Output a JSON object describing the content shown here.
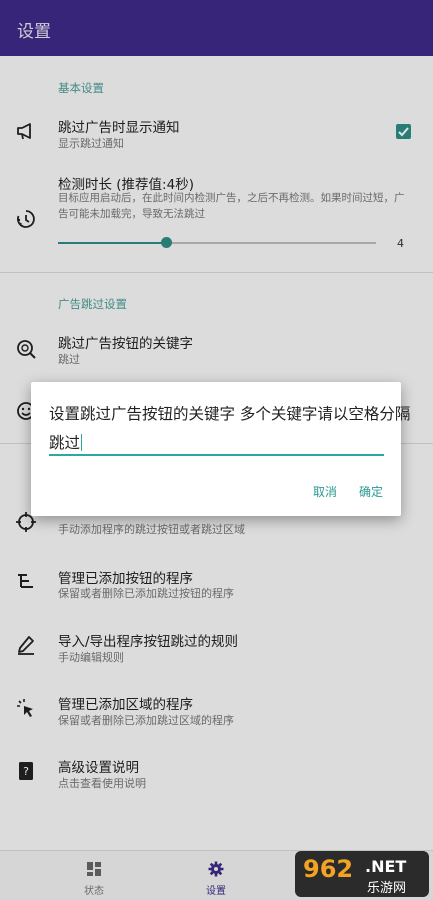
{
  "app": {
    "title": "设置"
  },
  "basic": {
    "section_title": "基本设置",
    "notify": {
      "title": "跳过广告时显示通知",
      "subtitle": "显示跳过通知",
      "checked": true
    },
    "duration": {
      "title": "检测时长 (推荐值:4秒)",
      "desc": "目标应用启动后，在此时间内检测广告，之后不再检测。如果时间过短，广告可能未加载完，导致无法跳过",
      "value": 4,
      "value_label": "4",
      "fraction": 0.34
    }
  },
  "ad_skip": {
    "section_title": "广告跳过设置",
    "keyword": {
      "title": "跳过广告按钮的关键字",
      "subtitle": "跳过"
    }
  },
  "list": {
    "add_rule_sub": "手动添加程序的跳过按钮或者跳过区域",
    "manage_buttons": {
      "title": "管理已添加按钮的程序",
      "subtitle": "保留或者删除已添加跳过按钮的程序"
    },
    "import_export": {
      "title": "导入/导出程序按钮跳过的规则",
      "subtitle": "手动编辑规则"
    },
    "manage_regions": {
      "title": "管理已添加区域的程序",
      "subtitle": "保留或者删除已添加跳过区域的程序"
    },
    "advanced": {
      "title": "高级设置说明",
      "subtitle": "点击查看使用说明"
    }
  },
  "dialog": {
    "title": "设置跳过广告按钮的关键字 多个关键字请以空格分隔",
    "input_value": "跳过",
    "cancel": "取消",
    "confirm": "确定"
  },
  "nav": {
    "status": "状态",
    "settings": "设置"
  },
  "watermark": {
    "number": "962",
    "net": ".NET",
    "cn": "乐游网"
  },
  "colors": {
    "header": "#3d2a86",
    "accent": "#2e8c85",
    "nav_active": "#3d2a86"
  }
}
